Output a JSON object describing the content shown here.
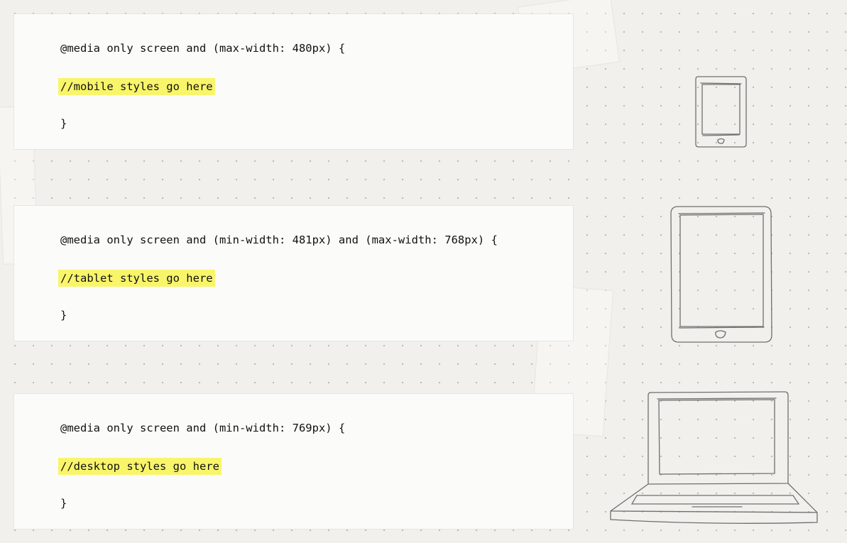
{
  "cards": [
    {
      "query": "@media only screen and (max-width: 480px) {",
      "comment": "//mobile styles go here",
      "close": "}",
      "device_icon": "phone-icon"
    },
    {
      "query": "@media only screen and (min-width: 481px) and (max-width: 768px) {",
      "comment": "//tablet styles go here",
      "close": "}",
      "device_icon": "tablet-icon"
    },
    {
      "query": "@media only screen and (min-width: 769px) {",
      "comment": "//desktop styles go here",
      "close": "}",
      "device_icon": "laptop-icon"
    }
  ],
  "colors": {
    "background": "#f1f0ec",
    "card": "#fbfbf9",
    "highlight": "#f9f56a",
    "sketch_stroke": "#6f6f6f"
  }
}
